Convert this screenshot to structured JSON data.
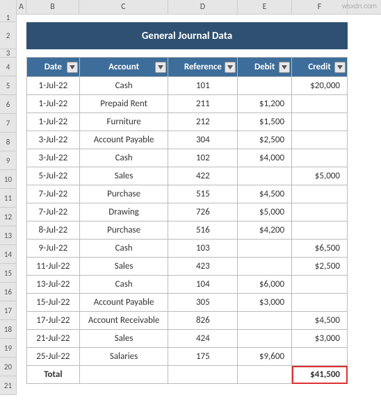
{
  "columns": [
    "A",
    "B",
    "C",
    "D",
    "E",
    "F"
  ],
  "row_numbers": [
    "1",
    "2",
    "3",
    "4",
    "5",
    "6",
    "7",
    "8",
    "9",
    "10",
    "11",
    "12",
    "13",
    "14",
    "15",
    "16",
    "17",
    "18",
    "19",
    "20",
    "21"
  ],
  "title": "General Journal Data",
  "headers": {
    "date": "Date",
    "account": "Account",
    "reference": "Reference",
    "debit": "Debit",
    "credit": "Credit"
  },
  "rows": [
    {
      "date": "1-Jul-22",
      "account": "Cash",
      "reference": "101",
      "debit": "",
      "credit": "$20,000"
    },
    {
      "date": "1-Jul-22",
      "account": "Prepaid Rent",
      "reference": "211",
      "debit": "$1,200",
      "credit": ""
    },
    {
      "date": "1-Jul-22",
      "account": "Furniture",
      "reference": "212",
      "debit": "$1,500",
      "credit": ""
    },
    {
      "date": "3-Jul-22",
      "account": "Account Payable",
      "reference": "304",
      "debit": "$2,500",
      "credit": ""
    },
    {
      "date": "3-Jul-22",
      "account": "Cash",
      "reference": "102",
      "debit": "$4,000",
      "credit": ""
    },
    {
      "date": "5-Jul-22",
      "account": "Sales",
      "reference": "422",
      "debit": "",
      "credit": "$5,000"
    },
    {
      "date": "7-Jul-22",
      "account": "Purchase",
      "reference": "515",
      "debit": "$4,500",
      "credit": ""
    },
    {
      "date": "7-Jul-22",
      "account": "Drawing",
      "reference": "726",
      "debit": "$5,000",
      "credit": ""
    },
    {
      "date": "8-Jul-22",
      "account": "Purchase",
      "reference": "516",
      "debit": "$4,200",
      "credit": ""
    },
    {
      "date": "9-Jul-22",
      "account": "Cash",
      "reference": "103",
      "debit": "",
      "credit": "$6,500"
    },
    {
      "date": "11-Jul-22",
      "account": "Sales",
      "reference": "423",
      "debit": "",
      "credit": "$2,500"
    },
    {
      "date": "13-Jul-22",
      "account": "Cash",
      "reference": "104",
      "debit": "$6,000",
      "credit": ""
    },
    {
      "date": "15-Jul-22",
      "account": "Account Payable",
      "reference": "305",
      "debit": "$3,000",
      "credit": ""
    },
    {
      "date": "17-Jul-22",
      "account": "Account Receivable",
      "reference": "826",
      "debit": "",
      "credit": "$4,500"
    },
    {
      "date": "21-Jul-22",
      "account": "Sales",
      "reference": "424",
      "debit": "",
      "credit": "$3,000"
    },
    {
      "date": "25-Jul-22",
      "account": "Salaries",
      "reference": "175",
      "debit": "$9,600",
      "credit": ""
    }
  ],
  "total": {
    "label": "Total",
    "credit": "$41,500"
  },
  "watermark": "wsxdn.com",
  "chart_data": {
    "type": "table",
    "title": "General Journal Data",
    "columns": [
      "Date",
      "Account",
      "Reference",
      "Debit",
      "Credit"
    ],
    "rows": [
      [
        "1-Jul-22",
        "Cash",
        101,
        null,
        20000
      ],
      [
        "1-Jul-22",
        "Prepaid Rent",
        211,
        1200,
        null
      ],
      [
        "1-Jul-22",
        "Furniture",
        212,
        1500,
        null
      ],
      [
        "3-Jul-22",
        "Account Payable",
        304,
        2500,
        null
      ],
      [
        "3-Jul-22",
        "Cash",
        102,
        4000,
        null
      ],
      [
        "5-Jul-22",
        "Sales",
        422,
        null,
        5000
      ],
      [
        "7-Jul-22",
        "Purchase",
        515,
        4500,
        null
      ],
      [
        "7-Jul-22",
        "Drawing",
        726,
        5000,
        null
      ],
      [
        "8-Jul-22",
        "Purchase",
        516,
        4200,
        null
      ],
      [
        "9-Jul-22",
        "Cash",
        103,
        null,
        6500
      ],
      [
        "11-Jul-22",
        "Sales",
        423,
        null,
        2500
      ],
      [
        "13-Jul-22",
        "Cash",
        104,
        6000,
        null
      ],
      [
        "15-Jul-22",
        "Account Payable",
        305,
        3000,
        null
      ],
      [
        "17-Jul-22",
        "Account Receivable",
        826,
        null,
        4500
      ],
      [
        "21-Jul-22",
        "Sales",
        424,
        null,
        3000
      ],
      [
        "25-Jul-22",
        "Salaries",
        175,
        9600,
        null
      ]
    ],
    "totals": {
      "credit": 41500
    }
  }
}
